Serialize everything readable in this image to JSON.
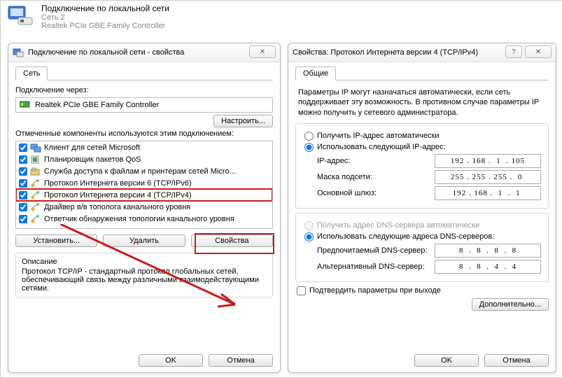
{
  "header": {
    "title": "Подключение по локальной сети",
    "line2": "Сеть 2",
    "line3": "Realtek PCIe GBE Family Controller"
  },
  "w1": {
    "title": "Подключение по локальной сети - свойства",
    "tab": "Сеть",
    "connect_label": "Подключение через:",
    "adapter": "Realtek PCIe GBE Family Controller",
    "configure_btn": "Настроить...",
    "components_label": "Отмеченные компоненты используются этим подключением:",
    "items": [
      "Клиент для сетей Microsoft",
      "Планировщик пакетов QoS",
      "Служба доступа к файлам и принтерам сетей Micro...",
      "Протокол Интернета версии 6 (TCP/IPv6)",
      "Протокол Интернета версии 4 (TCP/IPv4)",
      "Драйвер в/в тополога канального уровня",
      "Ответчик обнаружения топологии канального уровня"
    ],
    "install_btn": "Установить...",
    "remove_btn": "Удалить",
    "props_btn": "Свойства",
    "desc_title": "Описание",
    "desc_text": "Протокол TCP/IP - стандартный протокол глобальных сетей, обеспечивающий связь между различными взаимодействующими сетями.",
    "ok": "OK",
    "cancel": "Отмена"
  },
  "w2": {
    "title": "Свойства: Протокол Интернета версии 4 (TCP/IPv4)",
    "tab": "Общие",
    "intro": "Параметры IP могут назначаться автоматически, если сеть поддерживает эту возможность. В противном случае параметры IP можно получить у сетевого администратора.",
    "radio_auto_ip": "Получить IP-адрес автоматически",
    "radio_manual_ip": "Использовать следующий IP-адрес:",
    "ip_label": "IP-адрес:",
    "ip_value": "192 . 168 .  1  . 105",
    "mask_label": "Маска подсети:",
    "mask_value": "255 . 255 . 255 .  0 ",
    "gw_label": "Основной шлюз:",
    "gw_value": "192 . 168 .  1  .  1 ",
    "radio_auto_dns": "Получить адрес DNS-сервера автоматически",
    "radio_manual_dns": "Использовать следующие адреса DNS-серверов:",
    "dns1_label": "Предпочитаемый DNS-сервер:",
    "dns1_value": " 8  .  8  .  8  .  8 ",
    "dns2_label": "Альтернативный DNS-сервер:",
    "dns2_value": " 8  .  8  .  4  .  4 ",
    "validate_label": "Подтвердить параметры при выходе",
    "advanced_btn": "Дополнительно...",
    "ok": "OK",
    "cancel": "Отмена"
  }
}
